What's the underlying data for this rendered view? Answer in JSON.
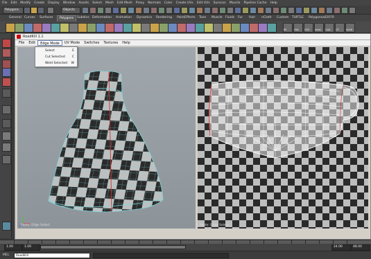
{
  "main_menu": [
    "File",
    "Edit",
    "Modify",
    "Create",
    "Display",
    "Window",
    "Assets",
    "Select",
    "Mesh",
    "Edit Mesh",
    "Proxy",
    "Normals",
    "Color",
    "Create UVs",
    "Edit UVs",
    "Surocon",
    "Muscle",
    "Pipeline Cache",
    "Help"
  ],
  "status": {
    "module": "Polygons",
    "objects_label": "Objects"
  },
  "shelf_tabs": [
    "General",
    "Curves",
    "Surfaces",
    "Polygons",
    "Subdivs",
    "Deformation",
    "Animation",
    "Dynamics",
    "Rendering",
    "PaintEffects",
    "Toon",
    "Muscle",
    "Fluids",
    "Fur",
    "Hair",
    "nCloth",
    "Custom",
    "TURTLE",
    "Polygonsall2070"
  ],
  "shelf_active_tab": "Polygons",
  "shelf_icon_labels": [
    "Rll",
    "Hist",
    "UVS",
    "Indal",
    "Outl",
    "CP",
    "Sph8"
  ],
  "roadkill": {
    "title": "RoadKill 1.1",
    "menu": [
      "File",
      "Edit",
      "Edge Mode",
      "UV Mode",
      "Switches",
      "Textures",
      "Help"
    ],
    "open_menu": "Edge Mode",
    "dropdown": [
      {
        "label": "Select",
        "key": "E"
      },
      {
        "label": "Cut Selected",
        "key": "C"
      },
      {
        "label": "Weld Selected",
        "key": "W"
      }
    ],
    "left_status": "Mode: Edge Select",
    "right_status": "Mode: Edge Select"
  },
  "timeline": {
    "start": "1.00",
    "current": "1.00",
    "end_range": "24.00",
    "end_total": "48.00",
    "current_frame": "24"
  },
  "command": {
    "lang": "MEL",
    "text": "RoadKill"
  },
  "colors": {
    "maya_bg": "#3b3b3b",
    "checker_dark": "#2a2a2a",
    "checker_light": "#bdbdbd",
    "wire": "#7fd7dc",
    "seam": "#d03030"
  }
}
